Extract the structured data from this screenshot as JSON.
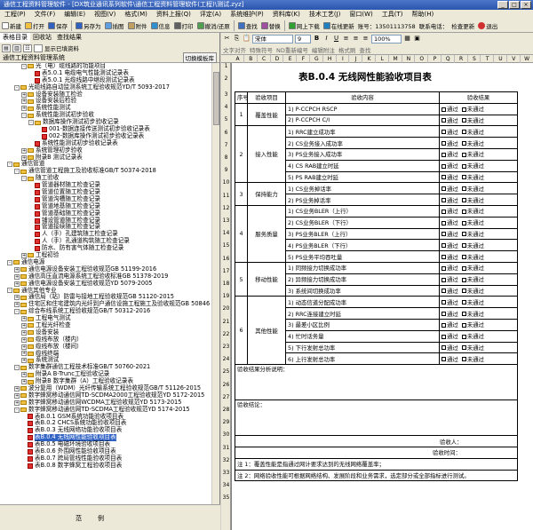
{
  "window": {
    "title": "通信工程资料管理软件 - [DX筑业通讯系列软件\\通信工程资料管理软件(工程)\\测试.zyz]"
  },
  "menu": [
    "工程(P)",
    "文件(F)",
    "编辑(E)",
    "视图(V)",
    "格式(M)",
    "资料上报(Q)",
    "评定(A)",
    "系统维护(P)",
    "资料库(K)",
    "技术工艺(J)",
    "窗口(W)",
    "工具(T)",
    "帮助(H)"
  ],
  "toolbar": {
    "buttons": [
      "新建",
      "打开",
      "保存",
      "另存为",
      "插图",
      "附件",
      "信息",
      "打印",
      "撤消/还原",
      "查找",
      "替换",
      "网上下载",
      "在线更新"
    ],
    "serial_label": "账号：",
    "serial_value": "13501113758",
    "phone_label": "联系电话：",
    "phone_value": "",
    "check_update": "检查更新",
    "exit": "退出"
  },
  "left": {
    "tabs": [
      "表格目录",
      "回收站",
      "查找结果"
    ],
    "show_checked": "显示已填资料",
    "header": "通信工程资料管理系统",
    "switch_label": "切换模板库",
    "legend": "范例"
  },
  "tree": [
    {
      "indent": 3,
      "type": "fold",
      "tg": "-",
      "text": "光（电）缆线路的功能项目"
    },
    {
      "indent": 4,
      "type": "doc",
      "text": "表5.0.1 电缆电气性能测试记录表"
    },
    {
      "indent": 4,
      "type": "doc",
      "text": "表5.0.1 光缆线路中继段测试记录表"
    },
    {
      "indent": 2,
      "type": "fold",
      "tg": "-",
      "text": "光缆线路自动监测系统工程验收规范YD/T 5093-2017"
    },
    {
      "indent": 3,
      "type": "fold",
      "tg": "+",
      "text": "设备安装随工检验"
    },
    {
      "indent": 3,
      "type": "fold",
      "tg": "+",
      "text": "设备安装后检验"
    },
    {
      "indent": 3,
      "type": "fold",
      "tg": "+",
      "text": "系统性能测试"
    },
    {
      "indent": 3,
      "type": "fold",
      "tg": "-",
      "text": "系统性能测试初步验收"
    },
    {
      "indent": 4,
      "type": "fold",
      "tg": "-",
      "text": "数据库操作测试初步验收记录"
    },
    {
      "indent": 5,
      "type": "doc",
      "text": "001-数据连接传送测试初步验收记录表"
    },
    {
      "indent": 5,
      "type": "doc",
      "text": "002-数据库操作测试初步验收记录表"
    },
    {
      "indent": 4,
      "type": "doc",
      "text": "系统性能测试初步验收记录表"
    },
    {
      "indent": 3,
      "type": "fold",
      "tg": "+",
      "text": "系统管理初步验收"
    },
    {
      "indent": 3,
      "type": "fold",
      "tg": "+",
      "text": "附录B 测试记录表"
    },
    {
      "indent": 1,
      "type": "fold",
      "tg": "-",
      "text": "通信管道"
    },
    {
      "indent": 2,
      "type": "fold",
      "tg": "-",
      "text": "通信管道工程施工及验收标准GB/T 50374-2018"
    },
    {
      "indent": 3,
      "type": "fold",
      "tg": "-",
      "text": "随工验收"
    },
    {
      "indent": 4,
      "type": "doc",
      "text": "管道器材随工检查记录"
    },
    {
      "indent": 4,
      "type": "doc",
      "text": "管道位置随工检查记录"
    },
    {
      "indent": 4,
      "type": "doc",
      "text": "管道沟槽随工检查记录"
    },
    {
      "indent": 4,
      "type": "doc",
      "text": "管道地基随工检查记录"
    },
    {
      "indent": 4,
      "type": "doc",
      "text": "管道基础随工检查记录"
    },
    {
      "indent": 4,
      "type": "doc",
      "text": "铺设管道随工检查记录"
    },
    {
      "indent": 4,
      "type": "doc",
      "text": "管道接续随工检查记录"
    },
    {
      "indent": 4,
      "type": "doc",
      "text": "人（手）孔建筑随工检查记录"
    },
    {
      "indent": 4,
      "type": "doc",
      "text": "人（手）孔通道构筑随工检查记录"
    },
    {
      "indent": 4,
      "type": "doc",
      "text": "防水、防有害气体随工检查记录"
    },
    {
      "indent": 3,
      "type": "fold",
      "tg": "+",
      "text": "工程初验"
    },
    {
      "indent": 1,
      "type": "fold",
      "tg": "-",
      "text": "通信电源"
    },
    {
      "indent": 2,
      "type": "fold",
      "tg": "+",
      "text": "通信电源设备安装工程验收规范GB 51199-2016"
    },
    {
      "indent": 2,
      "type": "fold",
      "tg": "+",
      "text": "通信高压直流电源系统工程验收标准GB 51378-2019"
    },
    {
      "indent": 2,
      "type": "fold",
      "tg": "+",
      "text": "通信电源设备安装工程验收规范YD 5079-2005"
    },
    {
      "indent": 1,
      "type": "fold",
      "tg": "-",
      "text": "通信其他专业"
    },
    {
      "indent": 2,
      "type": "fold",
      "tg": "+",
      "text": "通信局（站）防雷与接地工程验收规范GB 51120-2015"
    },
    {
      "indent": 2,
      "type": "fold",
      "tg": "+",
      "text": "住宅区和住宅建筑内光纤到户通信设施工程施工及验收规范GB 50846"
    },
    {
      "indent": 2,
      "type": "fold",
      "tg": "-",
      "text": "综合布线系统工程验收规范GB/T 50312-2016"
    },
    {
      "indent": 3,
      "type": "fold",
      "tg": "+",
      "text": "工程电气测试"
    },
    {
      "indent": 3,
      "type": "fold",
      "tg": "+",
      "text": "工程光纤检查"
    },
    {
      "indent": 3,
      "type": "fold",
      "tg": "+",
      "text": "设备安装"
    },
    {
      "indent": 3,
      "type": "fold",
      "tg": "+",
      "text": "缆线布放（楼内）"
    },
    {
      "indent": 3,
      "type": "fold",
      "tg": "+",
      "text": "缆线布放（楼间）"
    },
    {
      "indent": 3,
      "type": "fold",
      "tg": "+",
      "text": "缆线终端"
    },
    {
      "indent": 3,
      "type": "fold",
      "tg": "+",
      "text": "系统测试"
    },
    {
      "indent": 2,
      "type": "fold",
      "tg": "-",
      "text": "数字集群通信工程技术标准GB/T 50760-2021"
    },
    {
      "indent": 3,
      "type": "fold",
      "tg": "+",
      "text": "附录A B-Trunc工程验收记录"
    },
    {
      "indent": 3,
      "type": "fold",
      "tg": "+",
      "text": "附录B 数字集群（A）工程验收记录表"
    },
    {
      "indent": 2,
      "type": "fold",
      "tg": "+",
      "text": "波分复用（WDM）光纤传输系统工程验收规范GB/T 51126-2015"
    },
    {
      "indent": 2,
      "type": "fold",
      "tg": "+",
      "text": "数字蜂窝移动通信网TD-SCDMA2000工程验收规范YD 5172-2015"
    },
    {
      "indent": 2,
      "type": "fold",
      "tg": "+",
      "text": "数字蜂窝移动通信网WCDMA工程验收规范YD 5173-2015"
    },
    {
      "indent": 2,
      "type": "fold",
      "tg": "-",
      "text": "数字蜂窝移动通信网TD-SCDMA工程验收规范YD 5174-2015"
    },
    {
      "indent": 3,
      "type": "doc",
      "text": "表B.0.1 GSM系统功能验收项目表"
    },
    {
      "indent": 3,
      "type": "doc",
      "text": "表B.0.2 CHCS系统功能验收项目表"
    },
    {
      "indent": 3,
      "type": "doc",
      "text": "表B.0.3 无线网络功能验收项目表"
    },
    {
      "indent": 3,
      "type": "doc",
      "text": "表B.0.4 无线网性能验收项目表",
      "selected": true
    },
    {
      "indent": 3,
      "type": "doc",
      "text": "表B.0.5 电磁环境验收项目表"
    },
    {
      "indent": 3,
      "type": "doc",
      "text": "表B.0.6 外围网性能验收项目表"
    },
    {
      "indent": 3,
      "type": "doc",
      "text": "表B.0.7 跨局管线性能验收项目表"
    },
    {
      "indent": 3,
      "type": "doc",
      "text": "表B.0.8 数字蜂窝工程验收项目表"
    }
  ],
  "format_bar": {
    "font": "宋体",
    "size": "9",
    "zoom": "100%",
    "row2": [
      "文字对齐",
      "特殊符号",
      "ND重新编号",
      "编辑附注",
      "格式刷",
      "查找"
    ]
  },
  "sheet": {
    "title": "表B.0.4 无线网性能验收项目表",
    "headers": {
      "no": "序号",
      "item": "验收项目",
      "content": "验收内容",
      "result": "验收结果"
    },
    "pass": "通过",
    "fail": "未通过",
    "groups": [
      {
        "no": "1",
        "name": "覆盖性能",
        "rows": [
          "1) P-CCPCH  RSCP",
          "2) P-CCPCH  C/I"
        ]
      },
      {
        "no": "2",
        "name": "接入性能",
        "rows": [
          "1) RRC建立成功率",
          "2) CS业务接入成功率",
          "3) PS业务接入成功率",
          "4) CS RAB建立时延",
          "5) PS RAB建立时延"
        ]
      },
      {
        "no": "3",
        "name": "保持能力",
        "rows": [
          "1) CS业务掉话率",
          "2) PS业务掉话率"
        ]
      },
      {
        "no": "4",
        "name": "服务质量",
        "rows": [
          "1) CS业务BLER（上行）",
          "2) CS业务BLER（下行）",
          "3) PS业务BLER（上行）",
          "4) PS业务BLER（下行）",
          "5) PS业务平均吞吐量"
        ]
      },
      {
        "no": "5",
        "name": "移动性能",
        "rows": [
          "1) 同频接力切换成功率",
          "2) 异频接力切换成功率",
          "3) 系统间切换成功率"
        ]
      },
      {
        "no": "6",
        "name": "其他性能",
        "rows": [
          "1) 动态信道分配成功率",
          "2) RRC连接建立时延",
          "3) 最差小区比例",
          "4) 忙时话务量",
          "5) 下行发射总功率",
          "6) 上行发射总功率"
        ]
      }
    ],
    "conclusion_label": "验收结果分析说明：",
    "verdict_label": "验收结论：",
    "sign1": "验收人：",
    "sign2": "验收时间：",
    "note1": "注 1：覆盖性能是指通过网计要求达到的无线网络覆盖率；",
    "note2": "注 2：网络验收性能可根据网络结构、发展阶段和业务需求，选定部分或全部指标进行测试。"
  }
}
